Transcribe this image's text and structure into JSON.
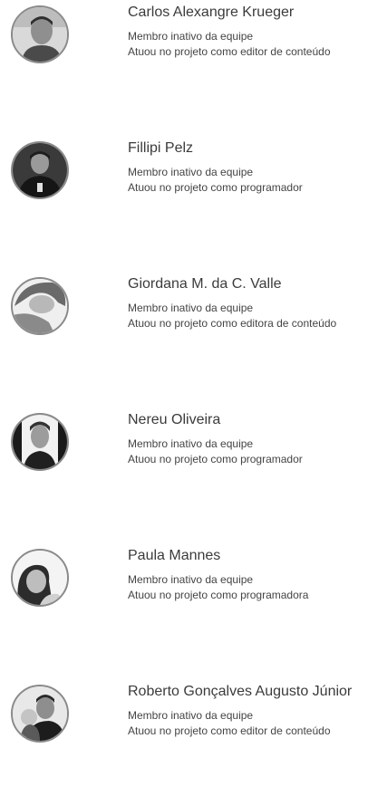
{
  "members": [
    {
      "name": "Carlos Alexangre Krueger",
      "status": "Membro inativo da equipe",
      "role": "Atuou no projeto como editor de conteúdo",
      "avatar_icon": "person-photo-icon"
    },
    {
      "name": "Fillipi Pelz",
      "status": "Membro inativo da equipe",
      "role": "Atuou no projeto como programador",
      "avatar_icon": "person-photo-icon"
    },
    {
      "name": "Giordana M. da C. Valle",
      "status": "Membro inativo da equipe",
      "role": "Atuou no projeto como editora de conteúdo",
      "avatar_icon": "person-photo-icon"
    },
    {
      "name": "Nereu Oliveira",
      "status": "Membro inativo da equipe",
      "role": "Atuou no projeto como programador",
      "avatar_icon": "person-photo-icon"
    },
    {
      "name": "Paula Mannes",
      "status": "Membro inativo da equipe",
      "role": "Atuou no projeto como programadora",
      "avatar_icon": "person-photo-icon"
    },
    {
      "name": "Roberto Gonçalves Augusto Júnior",
      "status": "Membro inativo da equipe",
      "role": "Atuou no projeto como editor de conteúdo",
      "avatar_icon": "person-photo-icon"
    }
  ],
  "colors": {
    "text_primary": "#3b3b3b",
    "text_secondary": "#444444",
    "avatar_border": "#8a8a8a",
    "background": "#ffffff"
  }
}
